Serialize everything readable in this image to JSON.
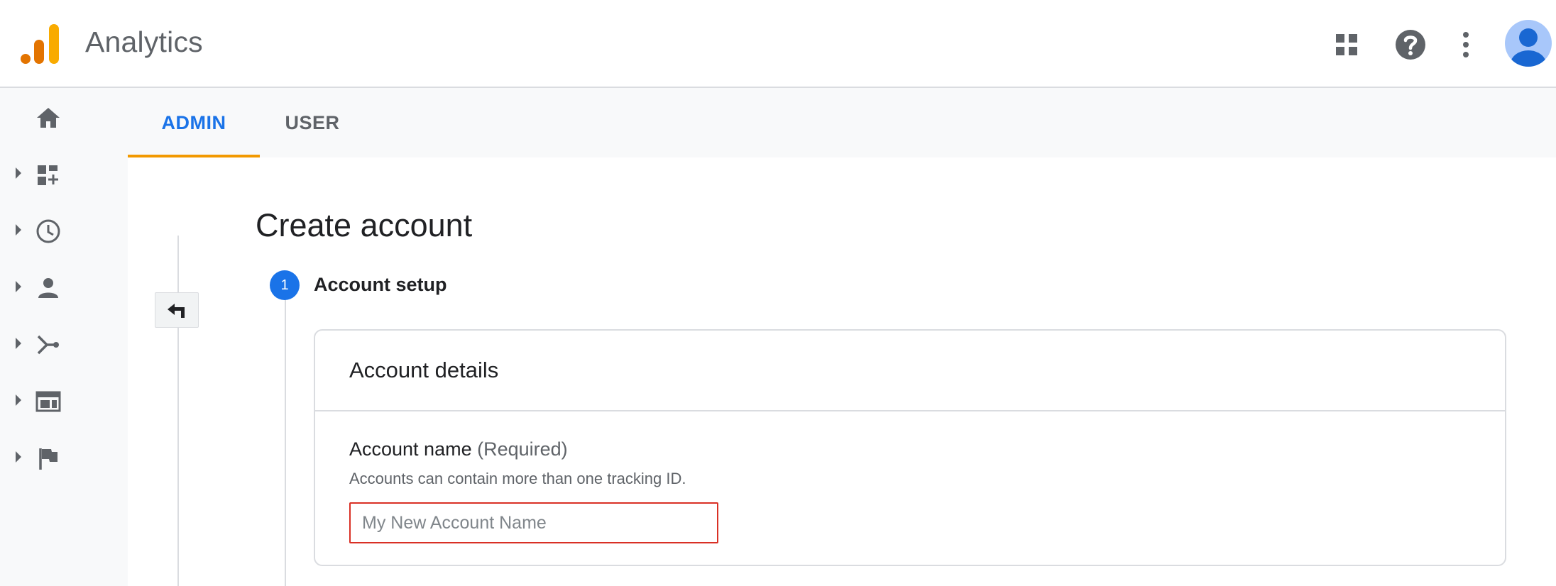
{
  "app": {
    "title": "Analytics"
  },
  "topbar": {
    "icons": [
      "apps-grid-icon",
      "help-icon",
      "more-vert-icon",
      "account-avatar-icon"
    ]
  },
  "colors": {
    "accent": "#1a73e8",
    "tab_underline": "#f29900",
    "error": "#d93025",
    "logo_dark": "#e37400",
    "logo_light": "#f9ab00"
  },
  "left_rail": {
    "items": [
      {
        "icon": "home-icon",
        "expandable": false
      },
      {
        "icon": "customization-icon",
        "expandable": true
      },
      {
        "icon": "realtime-clock-icon",
        "expandable": true
      },
      {
        "icon": "audience-person-icon",
        "expandable": true
      },
      {
        "icon": "acquisition-icon",
        "expandable": true
      },
      {
        "icon": "behavior-icon",
        "expandable": true
      },
      {
        "icon": "conversions-flag-icon",
        "expandable": true
      }
    ]
  },
  "tabs": [
    {
      "label": "ADMIN",
      "active": true
    },
    {
      "label": "USER",
      "active": false
    }
  ],
  "page": {
    "title": "Create account",
    "step": {
      "number": "1",
      "title": "Account setup"
    }
  },
  "card": {
    "title": "Account details",
    "field": {
      "label": "Account name",
      "required": "(Required)",
      "help": "Accounts can contain more than one tracking ID.",
      "placeholder": "My New Account Name",
      "value": ""
    }
  }
}
